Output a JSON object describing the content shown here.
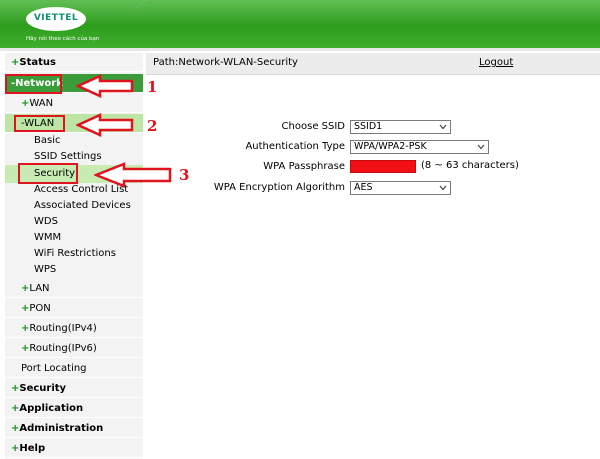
{
  "header": {
    "logo_text": "VIETTEL",
    "tagline": "Hãy nói theo cách của bạn",
    "colors": {
      "brand_green": "#3fae2c",
      "logo_teal": "#0f8f6f"
    }
  },
  "sidebar": {
    "status": "Status",
    "network": "Network",
    "wan": "WAN",
    "wlan": "WLAN",
    "basic": "Basic",
    "ssid_settings": "SSID Settings",
    "security": "Security",
    "access_control_list": "Access Control List",
    "associated_devices": "Associated Devices",
    "wds": "WDS",
    "wmm": "WMM",
    "wifi_restrictions": "WiFi Restrictions",
    "wps": "WPS",
    "lan": "LAN",
    "pon": "PON",
    "routing_ipv4": "Routing(IPv4)",
    "routing_ipv6": "Routing(IPv6)",
    "port_locating": "Port Locating",
    "security_main": "Security",
    "application": "Application",
    "administration": "Administration",
    "help": "Help",
    "plus": "+",
    "minus": "-"
  },
  "main": {
    "path": "Path:Network-WLAN-Security",
    "logout": "Logout",
    "form": {
      "choose_ssid_label": "Choose SSID",
      "choose_ssid_value": "SSID1",
      "auth_type_label": "Authentication Type",
      "auth_type_value": "WPA/WPA2-PSK",
      "passphrase_label": "WPA Passphrase",
      "passphrase_hint": "(8 ~ 63 characters)",
      "encryption_label": "WPA Encryption Algorithm",
      "encryption_value": "AES"
    }
  },
  "annotations": {
    "n1": "1",
    "n2": "2",
    "n3": "3",
    "color": "#e0141e"
  }
}
